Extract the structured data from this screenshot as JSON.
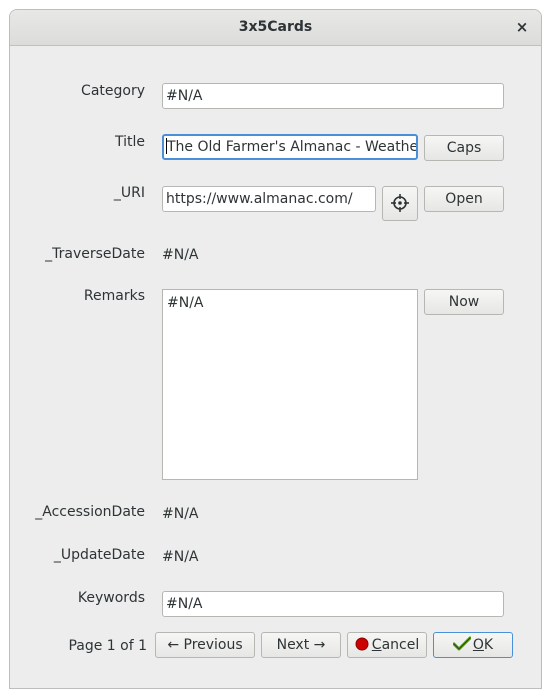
{
  "window": {
    "title": "3x5Cards",
    "close_glyph": "×"
  },
  "fields": {
    "category": {
      "label": "Category",
      "value": "#N/A"
    },
    "title": {
      "label": "Title",
      "value": "The Old Farmer's Almanac - Weather,",
      "button": "Caps"
    },
    "uri": {
      "label": "_URI",
      "value": "https://www.almanac.com/",
      "locate_icon": "crosshair-icon",
      "button": "Open"
    },
    "traverse_date": {
      "label": "_TraverseDate",
      "value": "#N/A"
    },
    "remarks": {
      "label": "Remarks",
      "value": "#N/A",
      "button": "Now"
    },
    "accession_date": {
      "label": "_AccessionDate",
      "value": "#N/A"
    },
    "update_date": {
      "label": "_UpdateDate",
      "value": "#N/A"
    },
    "keywords": {
      "label": "Keywords",
      "value": "#N/A"
    }
  },
  "footer": {
    "page_status": "Page 1 of 1",
    "previous": "← Previous",
    "next": "Next →",
    "cancel_mnemonic": "C",
    "cancel_rest": "ancel",
    "cancel_icon": "stop-circle-icon",
    "ok_mnemonic": "O",
    "ok_rest": "K",
    "ok_icon": "checkmark-icon",
    "cancel_icon_color": "#cc0000",
    "ok_icon_color": "#4e9a06"
  }
}
